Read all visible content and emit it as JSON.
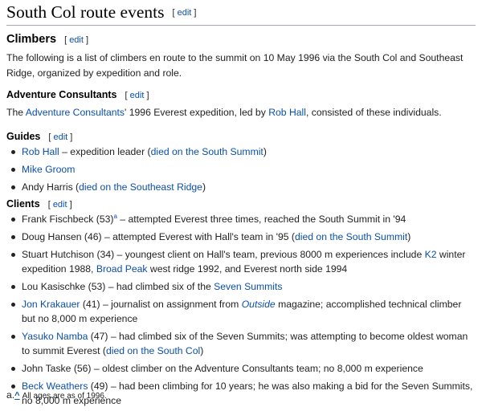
{
  "section_title": "South Col route events",
  "edit_label": "edit",
  "climbers_heading": "Climbers",
  "intro_text": "The following is a list of climbers en route to the summit on 10 May 1996 via the South Col and Southeast Ridge, organized by expedition and role.",
  "ac_heading": "Adventure Consultants",
  "ac_para": {
    "before": "The ",
    "link1": "Adventure Consultants",
    "middle": "' 1996 Everest expedition, led by ",
    "link2": "Rob Hall",
    "after": ", consisted of these individuals."
  },
  "guides_heading": "Guides",
  "guides": [
    {
      "name": "Rob Hall",
      "desc": " – expedition leader (",
      "link": "died on the South Summit",
      "end": ")"
    },
    {
      "name": "Mike Groom"
    },
    {
      "plain": "Andy Harris (",
      "link": "died on the Southeast Ridge",
      "end": ")"
    }
  ],
  "clients_heading": "Clients",
  "clients": {
    "fischbeck": {
      "text": "Frank Fischbeck (53)",
      "note": "a",
      "rest": " – attempted Everest three times, reached the South Summit in '94"
    },
    "hansen": {
      "text": "Doug Hansen (46) – attempted Everest with Hall's team in '95 (",
      "link": "died on the South Summit",
      "end": ")"
    },
    "hutchison": {
      "text": "Stuart Hutchison (34) – youngest client on Hall's team, previous 8000 m experiences include ",
      "link1": "K2",
      "mid1": " winter expedition 1988, ",
      "link2": "Broad Peak",
      "end": " west ridge 1992, and Everest north side 1994"
    },
    "kasischke": {
      "text": "Lou Kasischke (53) – had climbed six of the ",
      "link": "Seven Summits"
    },
    "krakauer": {
      "name": "Jon Krakauer",
      "text": " (41) – journalist on assignment from ",
      "italic": "Outside",
      "end": " magazine; accomplished technical climber but no 8,000 m experience"
    },
    "namba": {
      "name": "Yasuko Namba",
      "text": " (47) – had climbed six of the Seven Summits; was attempting to become oldest woman to summit Everest (",
      "link": "died on the South Col",
      "end": ")"
    },
    "taske": {
      "text": "John Taske (56) – oldest climber on the Adventure Consultants team; no 8,000 m experience"
    },
    "weathers": {
      "name": "Beck Weathers",
      "text": " (49) – had been climbing for 10 years; he was also making a bid for the Seven Summits, no 8,000 m experience"
    }
  },
  "footnote": {
    "label": "a.",
    "caret": "^",
    "text": "All ages are as of 1996."
  }
}
